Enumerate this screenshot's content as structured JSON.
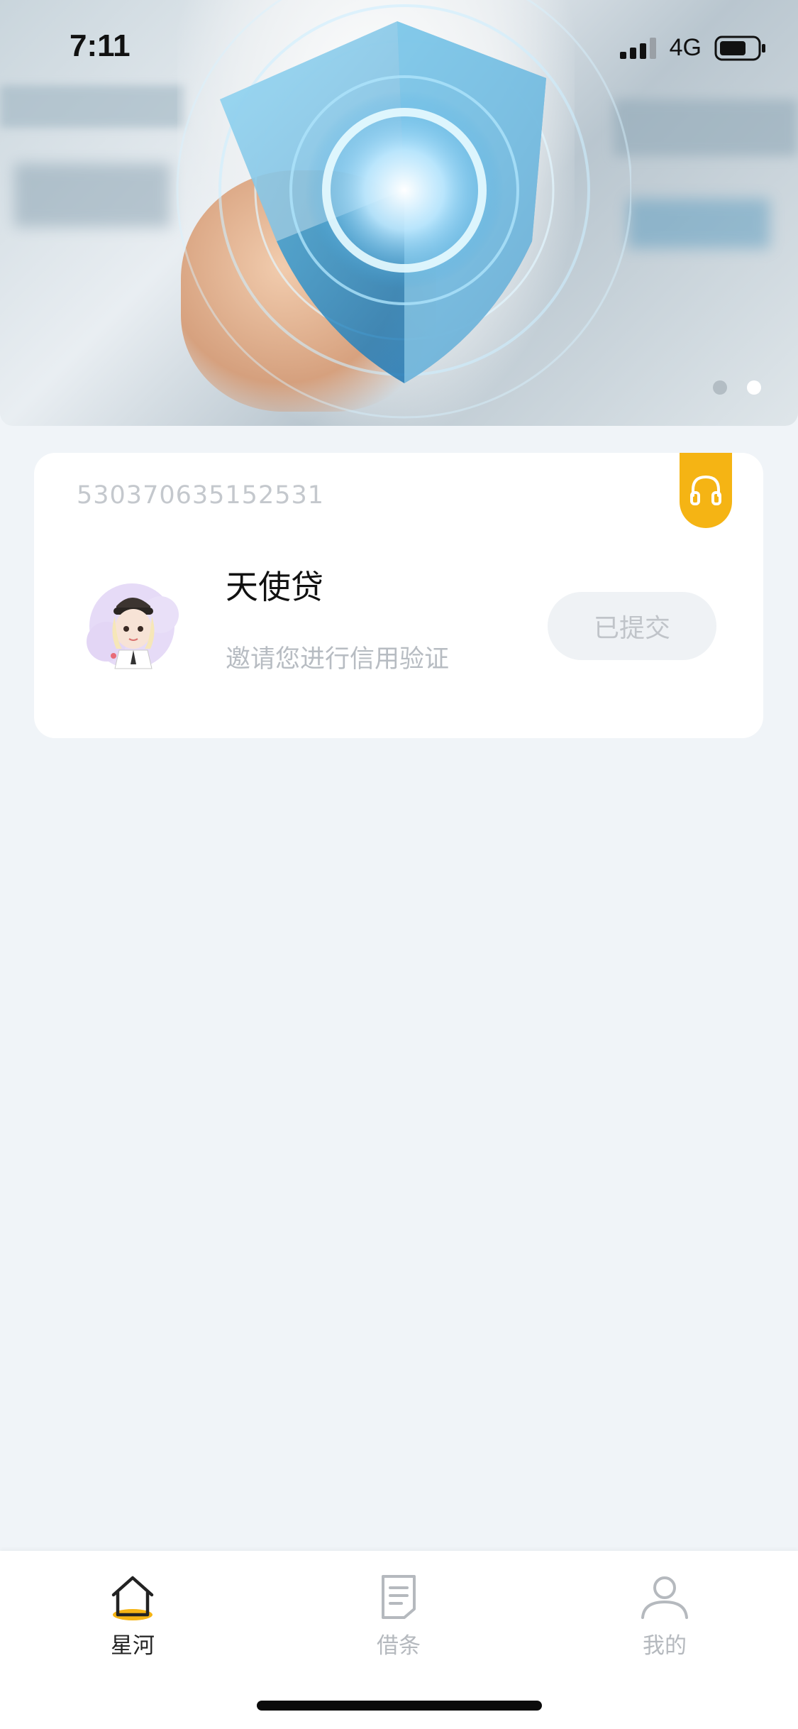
{
  "status_bar": {
    "time": "7:11",
    "network": "4G"
  },
  "banner": {
    "page_count": 2,
    "active_index": 1
  },
  "card": {
    "id": "530370635152531",
    "title": "天使贷",
    "subtitle": "邀请您进行信用验证",
    "status_button": "已提交"
  },
  "tabs": [
    {
      "label": "星河",
      "icon": "home-icon",
      "active": true
    },
    {
      "label": "借条",
      "icon": "document-icon",
      "active": false
    },
    {
      "label": "我的",
      "icon": "person-icon",
      "active": false
    }
  ],
  "colors": {
    "accent": "#f5b414",
    "background": "#f0f4f8"
  }
}
